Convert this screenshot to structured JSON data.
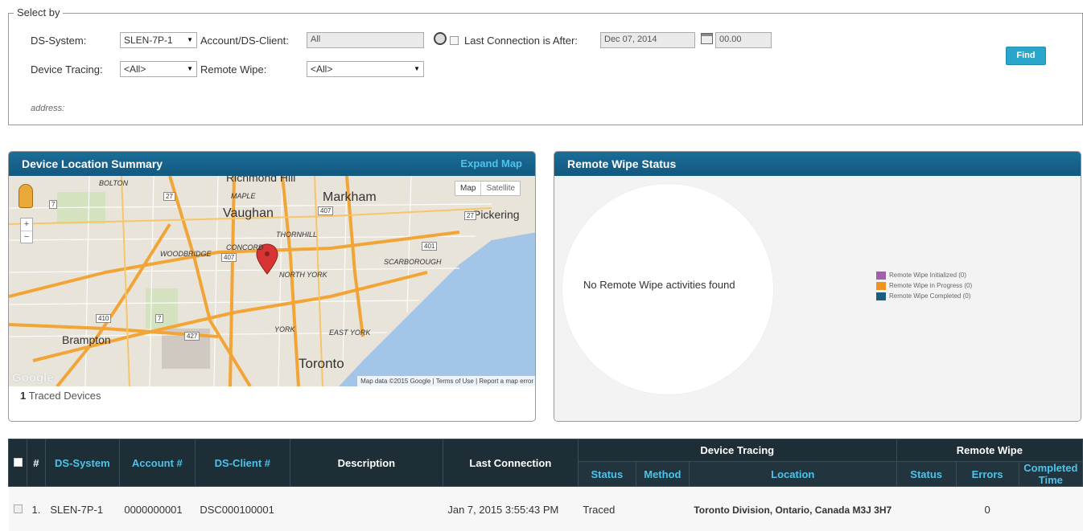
{
  "filter": {
    "legend": "Select by",
    "ds_system_label": "DS-System:",
    "ds_system_value": "SLEN-7P-1",
    "account_label": "Account/DS-Client:",
    "account_value": "All",
    "last_conn_label": "Last Connection is After:",
    "last_conn_date": "Dec 07, 2014",
    "last_conn_time": "00.00",
    "device_tracing_label": "Device Tracing:",
    "device_tracing_value": "<All>",
    "remote_wipe_label": "Remote Wipe:",
    "remote_wipe_value": "<All>",
    "address_label": "address:",
    "find_label": "Find"
  },
  "location_panel": {
    "title": "Device Location Summary",
    "expand_label": "Expand Map",
    "map_toggle": [
      "Map",
      "Satellite"
    ],
    "map_labels": {
      "richmond_hill": "Richmond Hill",
      "markham": "Markham",
      "vaughan": "Vaughan",
      "pickering": "Pickering",
      "maple": "MAPLE",
      "bolton": "BOLTON",
      "thornhill": "THORNHILL",
      "concord": "CONCORD",
      "woodbridge": "WOODBRIDGE",
      "north_york": "NORTH YORK",
      "scarborough": "SCARBOROUGH",
      "york": "YORK",
      "east_york": "EAST YORK",
      "brampton": "Brampton",
      "toronto": "Toronto",
      "google": "Google"
    },
    "map_shields": [
      "27",
      "7",
      "407",
      "401",
      "410",
      "427",
      "7",
      "27",
      "407"
    ],
    "map_footer": "Map data ©2015 Google | Terms of Use | Report a map error",
    "traced_count": "1",
    "traced_label": "Traced Devices"
  },
  "wipe_panel": {
    "title": "Remote Wipe Status",
    "empty_message": "No Remote Wipe activities found",
    "legend": [
      {
        "label": "Remote Wipe Initialized (0)",
        "color": "#a05fa8"
      },
      {
        "label": "Remote Wipe in Progress (0)",
        "color": "#f0921e"
      },
      {
        "label": "Remote Wipe Completed (0)",
        "color": "#1a5f7f"
      }
    ]
  },
  "table": {
    "headers": {
      "num": "#",
      "ds_system": "DS-System",
      "account": "Account #",
      "ds_client": "DS-Client #",
      "description": "Description",
      "last_connection": "Last Connection",
      "device_tracing": "Device Tracing",
      "remote_wipe": "Remote Wipe",
      "dt_status": "Status",
      "dt_method": "Method",
      "dt_location": "Location",
      "rw_status": "Status",
      "rw_errors": "Errors",
      "rw_completed": "Completed Time"
    },
    "rows": [
      {
        "num": "1.",
        "ds_system": "SLEN-7P-1",
        "account": "0000000001",
        "ds_client": "DSC000100001",
        "description": "",
        "last_connection": "Jan 7, 2015 3:55:43 PM",
        "dt_status": "Traced",
        "dt_method": "",
        "dt_location": "Toronto Division, Ontario, Canada M3J 3H7",
        "rw_status": "",
        "rw_errors": "0",
        "rw_completed": ""
      }
    ]
  }
}
